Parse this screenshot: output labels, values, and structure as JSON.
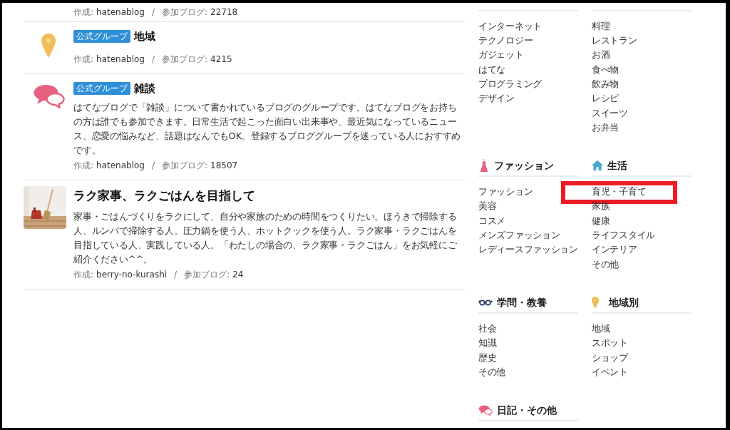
{
  "groups": [
    {
      "meta": {
        "created_label": "作成:",
        "creator": "hatenablog",
        "separator": "/",
        "count_label": "参加ブログ:",
        "count": "22718"
      }
    },
    {
      "badge": "公式グループ",
      "title": "地域",
      "meta": {
        "created_label": "作成:",
        "creator": "hatenablog",
        "separator": "/",
        "count_label": "参加ブログ:",
        "count": "4215"
      }
    },
    {
      "badge": "公式グループ",
      "title": "雑談",
      "description": "はてなブログで「雑談」について書かれているブログのグループです。はてなブログをお持ちの方は誰でも参加できます。日常生活で起こった面白い出来事や、最近気になっているニュース、恋愛の悩みなど、話題はなんでもOK。登録するブロググループを迷っている人におすすめです。",
      "meta": {
        "created_label": "作成:",
        "creator": "hatenablog",
        "separator": "/",
        "count_label": "参加ブログ:",
        "count": "18507"
      }
    },
    {
      "title": "ラク家事、ラクごはんを目指して",
      "description": "家事・ごはんづくりをラクにして、自分や家族のための時間をつくりたい。ほうきで掃除する人、ルンバで掃除する人。圧力鍋を使う人、ホットクックを使う人。ラク家事・ラクごはんを目指している人、実践している人。「わたしの場合の、ラク家事・ラクごはん」をお気軽にご紹介ください^^。",
      "meta": {
        "created_label": "作成:",
        "creator": "berry-no-kurashi",
        "separator": "/",
        "count_label": "参加ブログ:",
        "count": "24"
      }
    }
  ],
  "categories": [
    {
      "items": [
        {
          "label": "インターネット",
          "highlighted": false
        },
        {
          "label": "テクノロジー",
          "highlighted": false
        },
        {
          "label": "ガジェット",
          "highlighted": false
        },
        {
          "label": "はてな",
          "highlighted": false
        },
        {
          "label": "プログラミング",
          "highlighted": false
        },
        {
          "label": "デザイン",
          "highlighted": false
        }
      ]
    },
    {
      "items": [
        {
          "label": "料理",
          "highlighted": false
        },
        {
          "label": "レストラン",
          "highlighted": false
        },
        {
          "label": "お酒",
          "highlighted": false
        },
        {
          "label": "食べ物",
          "highlighted": false
        },
        {
          "label": "飲み物",
          "highlighted": false
        },
        {
          "label": "レシピ",
          "highlighted": false
        },
        {
          "label": "スイーツ",
          "highlighted": false
        },
        {
          "label": "お弁当",
          "highlighted": false
        }
      ]
    },
    {
      "heading": "ファッション",
      "items": [
        {
          "label": "ファッション",
          "highlighted": false
        },
        {
          "label": "美容",
          "highlighted": false
        },
        {
          "label": "コスメ",
          "highlighted": false
        },
        {
          "label": "メンズファッション",
          "highlighted": false
        },
        {
          "label": "レディースファッション",
          "highlighted": false
        }
      ]
    },
    {
      "heading": "生活",
      "items": [
        {
          "label": "育児・子育て",
          "highlighted": true
        },
        {
          "label": "家族",
          "highlighted": false
        },
        {
          "label": "健康",
          "highlighted": false
        },
        {
          "label": "ライフスタイル",
          "highlighted": false
        },
        {
          "label": "インテリア",
          "highlighted": false
        },
        {
          "label": "その他",
          "highlighted": false
        }
      ]
    },
    {
      "heading": "学問・教養",
      "items": [
        {
          "label": "社会",
          "highlighted": false
        },
        {
          "label": "知識",
          "highlighted": false
        },
        {
          "label": "歴史",
          "highlighted": false
        },
        {
          "label": "その他",
          "highlighted": false
        }
      ]
    },
    {
      "heading": "地域別",
      "items": [
        {
          "label": "地域",
          "highlighted": false
        },
        {
          "label": "スポット",
          "highlighted": false
        },
        {
          "label": "ショップ",
          "highlighted": false
        },
        {
          "label": "イベント",
          "highlighted": false
        }
      ]
    },
    {
      "heading": "日記・その他"
    }
  ]
}
